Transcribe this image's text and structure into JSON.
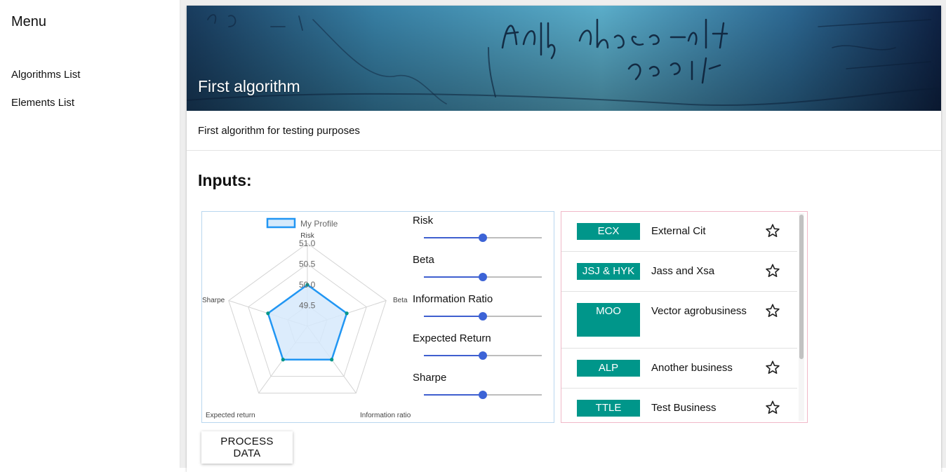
{
  "sidebar": {
    "title": "Menu",
    "items": [
      {
        "label": "Algorithms List"
      },
      {
        "label": "Elements List"
      }
    ]
  },
  "algorithm": {
    "banner_title": "First algorithm",
    "banner_handwriting": "Apply phase-shift operator",
    "description": "First algorithm for testing purposes"
  },
  "inputs": {
    "heading": "Inputs:"
  },
  "chart_data": {
    "type": "radar",
    "legend": "My Profile",
    "axes": [
      "Risk",
      "Beta",
      "Information ratio",
      "Expected return",
      "Sharpe"
    ],
    "series": [
      {
        "name": "My Profile",
        "values": [
          50,
          50,
          50,
          50,
          50
        ]
      }
    ],
    "range": [
      49,
      51
    ],
    "ticks": [
      "49.5",
      "50.0",
      "50.5",
      "51.0"
    ],
    "colors": {
      "line": "#2196f3",
      "fill": "#d6e9fb",
      "point": "#00968a"
    }
  },
  "sliders": [
    {
      "label": "Risk",
      "value": 0.5
    },
    {
      "label": "Beta",
      "value": 0.5
    },
    {
      "label": "Information Ratio",
      "value": 0.5
    },
    {
      "label": "Expected Return",
      "value": 0.5
    },
    {
      "label": "Sharpe",
      "value": 0.5
    }
  ],
  "elements": [
    {
      "code": "ECX",
      "name": "External Cit"
    },
    {
      "code": "JSJ & HYK",
      "name": "Jass and Xsa"
    },
    {
      "code": "MOO",
      "name": "Vector agrobusiness"
    },
    {
      "code": "ALP",
      "name": "Another business"
    },
    {
      "code": "TTLE",
      "name": "Test Business"
    }
  ],
  "actions": {
    "process_label": "PROCESS DATA"
  },
  "colors": {
    "badge": "#00968a",
    "slider": "#3c63d6"
  }
}
